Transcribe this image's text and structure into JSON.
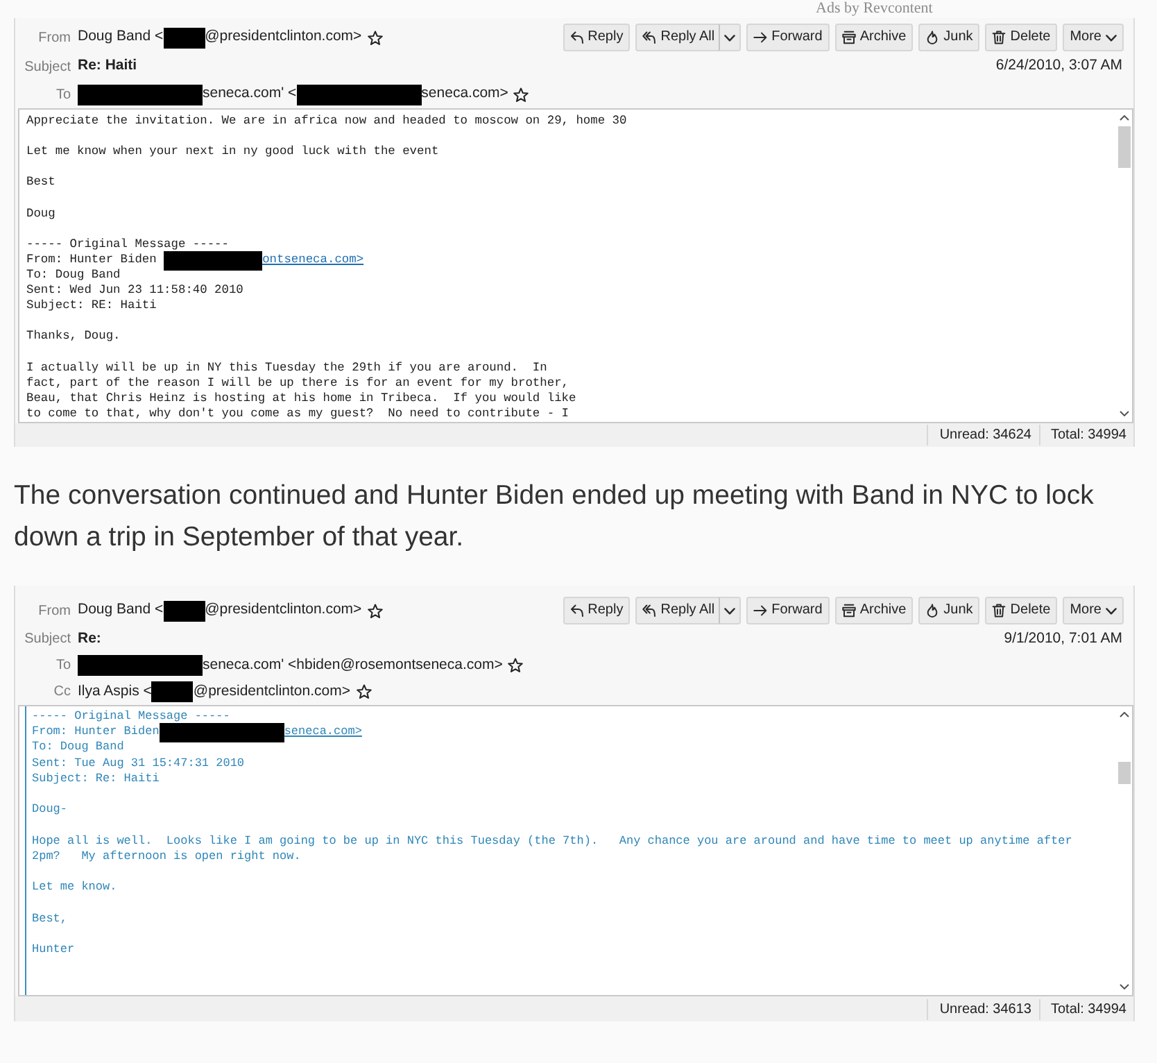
{
  "ad_label": "Ads by Revcontent",
  "content": [
    {
      "kind": "email",
      "toolbar": [
        {
          "kind": "reply",
          "label": "Reply"
        },
        {
          "kind": "reply-all",
          "label": "Reply All",
          "split": true
        },
        {
          "kind": "forward",
          "label": "Forward"
        },
        {
          "kind": "archive",
          "label": "Archive"
        },
        {
          "kind": "junk",
          "label": "Junk"
        },
        {
          "kind": "delete",
          "label": "Delete"
        },
        {
          "kind": "more",
          "label": "More"
        }
      ],
      "fields": [
        {
          "kind": "address",
          "label": "From",
          "parts": [
            {
              "kind": "text",
              "text": "Doug Band <"
            },
            {
              "kind": "redaction-short"
            },
            {
              "kind": "text",
              "text": "@presidentclinton.com>"
            }
          ]
        },
        {
          "kind": "subject",
          "label": "Subject",
          "value": "Re: Haiti",
          "date": "6/24/2010, 3:07 AM"
        },
        {
          "kind": "address",
          "label": "To",
          "parts": [
            {
              "kind": "redaction-long"
            },
            {
              "kind": "text",
              "text": "seneca.com' <"
            },
            {
              "kind": "redaction-long"
            },
            {
              "kind": "text",
              "text": "seneca.com>"
            }
          ]
        }
      ],
      "body": {
        "quoted": false,
        "paragraphs": [
          [
            "Appreciate the invitation. We are in africa now and headed to moscow on 29, home 30"
          ],
          [
            "Let me know when your next in ny good luck with the event"
          ],
          [
            "Best"
          ],
          [
            "Doug"
          ],
          [
            "----- Original Message -----",
            [
              {
                "kind": "text",
                "text": "From: Hunter Biden "
              },
              {
                "kind": "redaction-medium"
              },
              {
                "kind": "link",
                "text": "ontseneca.com>"
              }
            ],
            "To: Doug Band",
            "Sent: Wed Jun 23 11:58:40 2010",
            "Subject: RE: Haiti"
          ],
          [
            "Thanks, Doug."
          ],
          [
            "I actually will be up in NY this Tuesday the 29th if you are around.  In",
            "fact, part of the reason I will be up there is for an event for my brother,",
            "Beau, that Chris Heinz is hosting at his home in Tribeca.  If you would like",
            "to come to that, why don't you come as my guest?  No need to contribute - I"
          ]
        ]
      },
      "status_bar": {
        "unread": "Unread: 34624",
        "total": "Total: 34994"
      }
    },
    {
      "kind": "paragraph",
      "text": "The conversation continued and Hunter Biden ended up meeting with Band in NYC to lock down a trip in September of that year."
    },
    {
      "kind": "email",
      "toolbar": [
        {
          "kind": "reply",
          "label": "Reply"
        },
        {
          "kind": "reply-all",
          "label": "Reply All",
          "split": true
        },
        {
          "kind": "forward",
          "label": "Forward"
        },
        {
          "kind": "archive",
          "label": "Archive"
        },
        {
          "kind": "junk",
          "label": "Junk"
        },
        {
          "kind": "delete",
          "label": "Delete"
        },
        {
          "kind": "more",
          "label": "More"
        }
      ],
      "fields": [
        {
          "kind": "address",
          "label": "From",
          "parts": [
            {
              "kind": "text",
              "text": "Doug Band <"
            },
            {
              "kind": "redaction-short"
            },
            {
              "kind": "text",
              "text": "@presidentclinton.com>"
            }
          ]
        },
        {
          "kind": "subject",
          "label": "Subject",
          "value": "Re:",
          "date": "9/1/2010, 7:01 AM"
        },
        {
          "kind": "address",
          "label": "To",
          "parts": [
            {
              "kind": "redaction-long"
            },
            {
              "kind": "text",
              "text": "seneca.com' <hbiden@rosemontseneca.com>"
            }
          ]
        },
        {
          "kind": "address",
          "label": "Cc",
          "parts": [
            {
              "kind": "text",
              "text": "Ilya Aspis <"
            },
            {
              "kind": "redaction-short"
            },
            {
              "kind": "text",
              "text": "@presidentclinton.com>"
            }
          ]
        }
      ],
      "body": {
        "quoted": true,
        "paragraphs": [
          [
            "----- Original Message -----",
            [
              {
                "kind": "text",
                "text": "From: Hunter Biden"
              },
              {
                "kind": "redaction-long"
              },
              {
                "kind": "link",
                "text": "seneca.com>"
              }
            ],
            "To: Doug Band",
            "Sent: Tue Aug 31 15:47:31 2010",
            "Subject: Re: Haiti"
          ],
          [
            "Doug-"
          ],
          [
            "Hope all is well.  Looks like I am going to be up in NYC this Tuesday (the 7th).   Any chance you are around and have time to meet up anytime after",
            "2pm?   My afternoon is open right now."
          ],
          [
            "Let me know."
          ],
          [
            "Best,"
          ],
          [
            "Hunter"
          ]
        ]
      },
      "status_bar": {
        "unread": "Unread: 34613",
        "total": "Total: 34994"
      }
    }
  ]
}
